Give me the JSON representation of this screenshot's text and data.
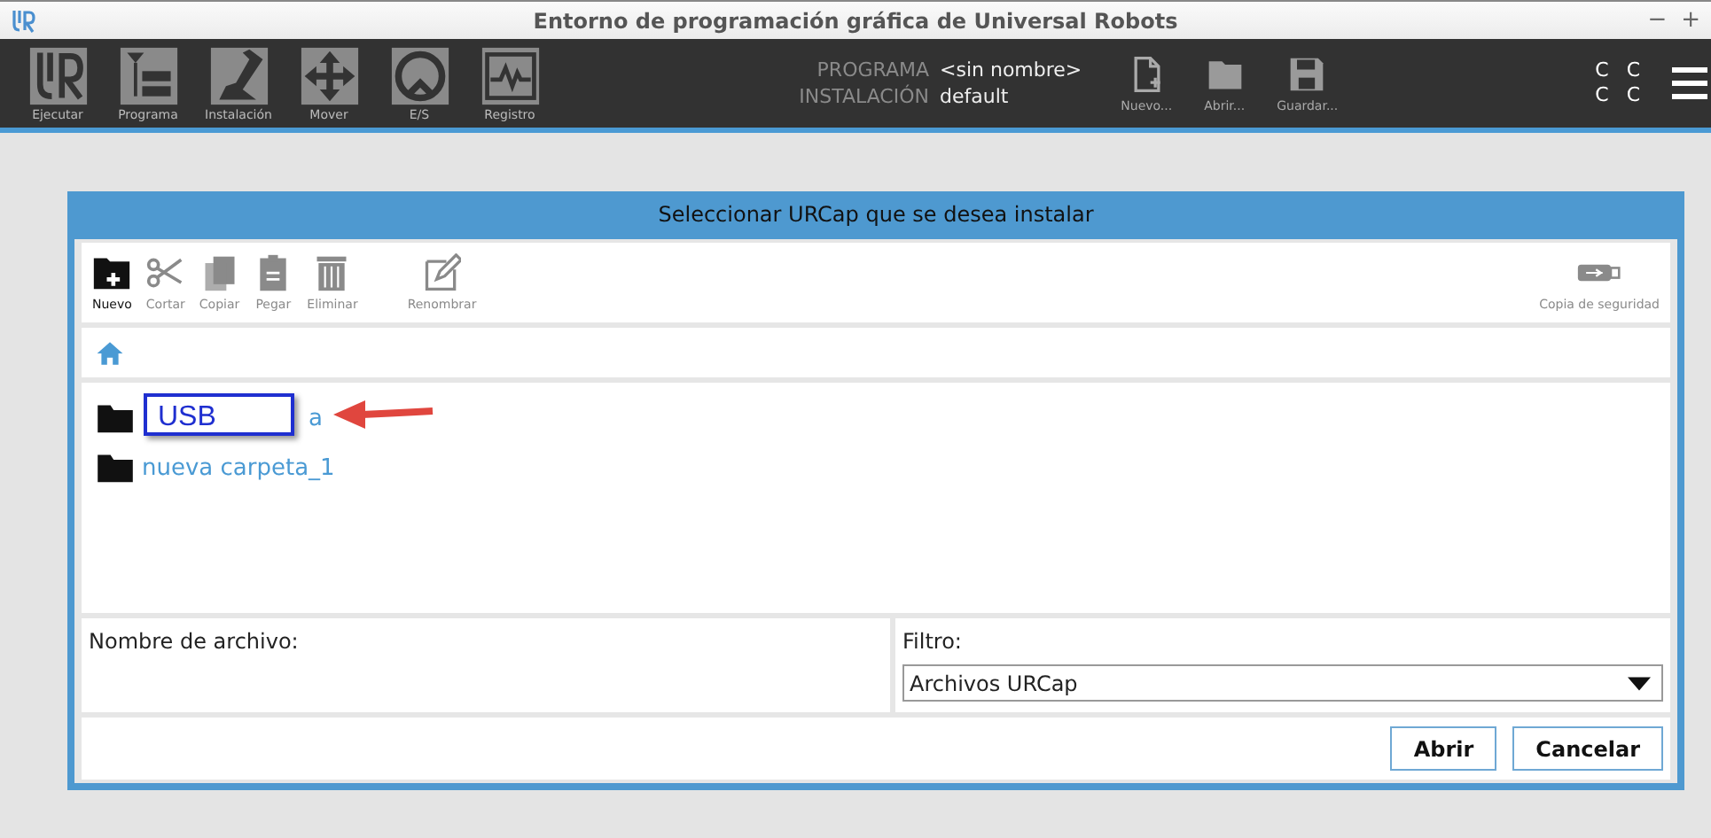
{
  "window": {
    "title": "Entorno de programación gráfica de Universal Robots",
    "controls": [
      "−",
      "+"
    ]
  },
  "nav": [
    {
      "label": "Ejecutar"
    },
    {
      "label": "Programa"
    },
    {
      "label": "Instalación"
    },
    {
      "label": "Mover"
    },
    {
      "label": "E/S"
    },
    {
      "label": "Registro"
    }
  ],
  "program_info": {
    "program_label": "PROGRAMA",
    "program_value": "<sin nombre>",
    "installation_label": "INSTALACIÓN",
    "installation_value": "default"
  },
  "file_actions": [
    {
      "label": "Nuevo..."
    },
    {
      "label": "Abrir..."
    },
    {
      "label": "Guardar..."
    }
  ],
  "status_letters": [
    "C",
    "C",
    "C",
    "C"
  ],
  "dialog": {
    "title": "Seleccionar URCap que se desea instalar",
    "toolbar": [
      {
        "label": "Nuevo",
        "disabled": false
      },
      {
        "label": "Cortar",
        "disabled": true
      },
      {
        "label": "Copiar",
        "disabled": true
      },
      {
        "label": "Pegar",
        "disabled": true
      },
      {
        "label": "Eliminar",
        "disabled": true
      },
      {
        "label": "Renombrar",
        "disabled": true
      }
    ],
    "backup": {
      "label": "Copia de seguridad",
      "disabled": true
    },
    "files": [
      {
        "name": "a"
      },
      {
        "name": "nueva carpeta_1"
      }
    ],
    "callout": {
      "text": "USB"
    },
    "filename_label": "Nombre de archivo:",
    "filter_label": "Filtro:",
    "filter_value": "Archivos URCap",
    "buttons": [
      "Abrir",
      "Cancelar"
    ]
  }
}
